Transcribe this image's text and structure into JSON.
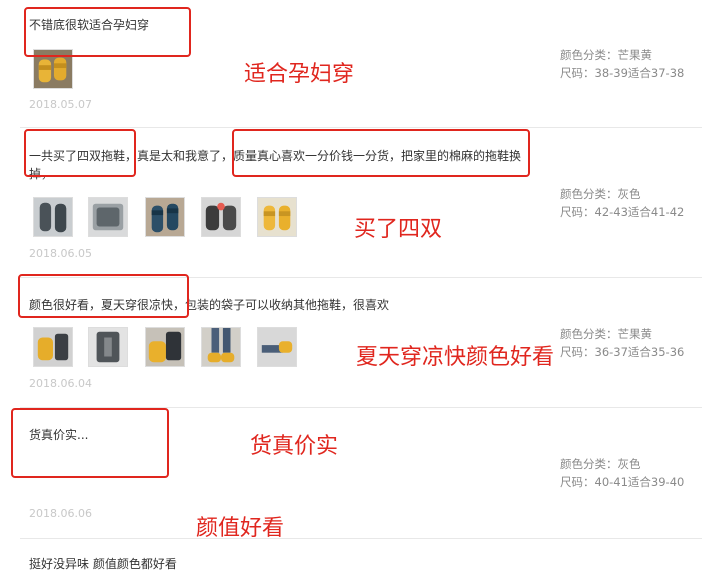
{
  "reviews": [
    {
      "text": "不错底很软适合孕妇穿",
      "date": "2018.05.07",
      "color_label": "颜色分类：",
      "color_value": "芒果黄",
      "size_label": "尺码：",
      "size_value": "38-39适合37-38",
      "annotation": "适合孕妇穿"
    },
    {
      "text_line1": "一共买了四双拖鞋，真是太和我意了，质量真心喜欢一分价钱一分货，把家里的棉麻的拖鞋换",
      "text_line2": "掉，",
      "date": "2018.06.05",
      "color_label": "颜色分类：",
      "color_value": "灰色",
      "size_label": "尺码：",
      "size_value": "42-43适合41-42",
      "annotation": "买了四双"
    },
    {
      "text": "颜色很好看，夏天穿很凉快，包装的袋子可以收纳其他拖鞋，很喜欢",
      "date": "2018.06.04",
      "color_label": "颜色分类：",
      "color_value": "芒果黄",
      "size_label": "尺码：",
      "size_value": "36-37适合35-36",
      "annotation": "夏天穿凉快颜色好看"
    },
    {
      "text": "货真价实...",
      "date": "2018.06.06",
      "color_label": "颜色分类：",
      "color_value": "灰色",
      "size_label": "尺码：",
      "size_value": "40-41适合39-40",
      "annotation": "货真价实"
    },
    {
      "text": "挺好没异味 颜值颜色都好看",
      "annotation": "颜值好看"
    }
  ],
  "colors": {
    "accent_red": "#e0261e",
    "meta_gray": "#8a8a8a",
    "date_gray": "#c8c8c8"
  }
}
